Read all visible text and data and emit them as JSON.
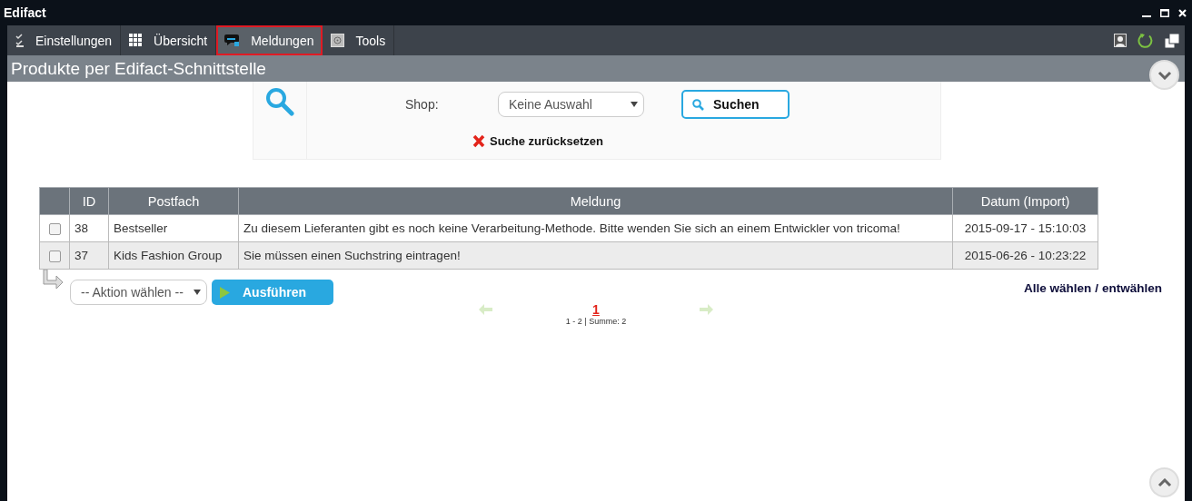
{
  "window": {
    "title": "Edifact"
  },
  "menu": [
    {
      "label": "Einstellungen",
      "selected": false
    },
    {
      "label": "Übersicht",
      "selected": false
    },
    {
      "label": "Meldungen",
      "selected": true
    },
    {
      "label": "Tools",
      "selected": false
    }
  ],
  "page_title": "Produkte per Edifact-Schnittstelle",
  "search": {
    "shop_label": "Shop:",
    "shop_value": "Keine Auswahl",
    "search_button": "Suchen",
    "reset": "Suche zurücksetzen"
  },
  "table": {
    "columns": [
      "ID",
      "Postfach",
      "Meldung",
      "Datum (Import)"
    ],
    "rows": [
      {
        "checked": false,
        "id": "38",
        "postfach": "Bestseller",
        "meldung": "Zu diesem Lieferanten gibt es noch keine Verarbeitung-Methode. Bitte wenden Sie sich an einem Entwickler von tricoma!",
        "datum": "2015-09-17 - 15:10:03"
      },
      {
        "checked": false,
        "id": "37",
        "postfach": "Kids Fashion Group",
        "meldung": "Sie müssen einen Suchstring eintragen!",
        "datum": "2015-06-26 - 10:23:22"
      }
    ]
  },
  "actions": {
    "select": "-- Aktion wählen --",
    "run_button": "Ausführen",
    "select_all": "Alle wählen",
    "separator": "/",
    "deselect_all": "entwählen"
  },
  "pager": {
    "current": "1",
    "summary": "1 - 2 | Summe: 2"
  }
}
